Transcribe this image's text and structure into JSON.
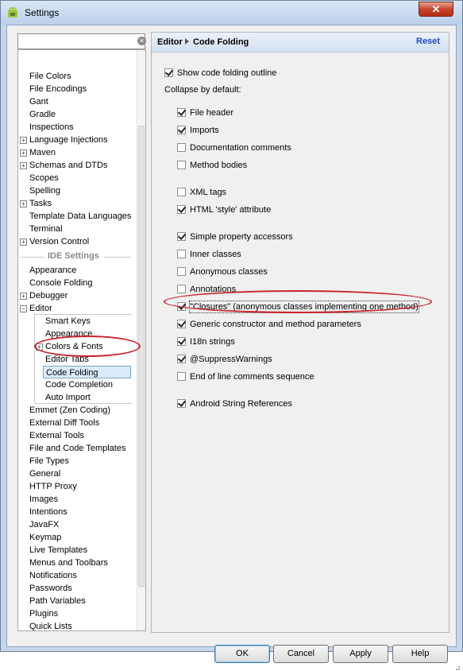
{
  "window": {
    "title": "Settings",
    "close_symbol": "✕"
  },
  "search": {
    "value": "",
    "placeholder": "",
    "clear_symbol": "✕"
  },
  "tree": {
    "top_items": [
      {
        "label": "File Colors",
        "expandable": false
      },
      {
        "label": "File Encodings",
        "expandable": false
      },
      {
        "label": "Gant",
        "expandable": false
      },
      {
        "label": "Gradle",
        "expandable": false
      },
      {
        "label": "Inspections",
        "expandable": false
      },
      {
        "label": "Language Injections",
        "expandable": true
      },
      {
        "label": "Maven",
        "expandable": true
      },
      {
        "label": "Schemas and DTDs",
        "expandable": true
      },
      {
        "label": "Scopes",
        "expandable": false
      },
      {
        "label": "Spelling",
        "expandable": false
      },
      {
        "label": "Tasks",
        "expandable": true
      },
      {
        "label": "Template Data Languages",
        "expandable": false
      },
      {
        "label": "Terminal",
        "expandable": false
      },
      {
        "label": "Version Control",
        "expandable": true
      }
    ],
    "section_label": "IDE Settings",
    "ide_items": [
      {
        "label": "Appearance",
        "expandable": false
      },
      {
        "label": "Console Folding",
        "expandable": false
      },
      {
        "label": "Debugger",
        "expandable": true
      },
      {
        "label": "Editor",
        "expandable": true,
        "expanded": true
      }
    ],
    "editor_children": [
      {
        "label": "Smart Keys",
        "expandable": false
      },
      {
        "label": "Appearance",
        "expandable": false
      },
      {
        "label": "Colors & Fonts",
        "expandable": true
      },
      {
        "label": "Editor Tabs",
        "expandable": false
      },
      {
        "label": "Code Folding",
        "expandable": false,
        "selected": true
      },
      {
        "label": "Code Completion",
        "expandable": false
      },
      {
        "label": "Auto Import",
        "expandable": false
      }
    ],
    "bottom_items": [
      {
        "label": "Emmet (Zen Coding)",
        "expandable": false
      },
      {
        "label": "External Diff Tools",
        "expandable": false
      },
      {
        "label": "External Tools",
        "expandable": false
      },
      {
        "label": "File and Code Templates",
        "expandable": false
      },
      {
        "label": "File Types",
        "expandable": false
      },
      {
        "label": "General",
        "expandable": false
      },
      {
        "label": "HTTP Proxy",
        "expandable": false
      },
      {
        "label": "Images",
        "expandable": false
      },
      {
        "label": "Intentions",
        "expandable": false
      },
      {
        "label": "JavaFX",
        "expandable": false
      },
      {
        "label": "Keymap",
        "expandable": false
      },
      {
        "label": "Live Templates",
        "expandable": false
      },
      {
        "label": "Menus and Toolbars",
        "expandable": false
      },
      {
        "label": "Notifications",
        "expandable": false
      },
      {
        "label": "Passwords",
        "expandable": false
      },
      {
        "label": "Path Variables",
        "expandable": false
      },
      {
        "label": "Plugins",
        "expandable": false
      },
      {
        "label": "Quick Lists",
        "expandable": false
      }
    ]
  },
  "panel": {
    "breadcrumb": [
      "Editor",
      "Code Folding"
    ],
    "reset_label": "Reset",
    "show_outline": {
      "label": "Show code folding outline",
      "checked": true
    },
    "collapse_label": "Collapse by default:",
    "options": [
      {
        "label": "File header",
        "checked": true
      },
      {
        "label": "Imports",
        "checked": true
      },
      {
        "label": "Documentation comments",
        "checked": false
      },
      {
        "label": "Method bodies",
        "checked": false
      },
      {
        "label": "XML tags",
        "checked": false
      },
      {
        "label": "HTML 'style' attribute",
        "checked": true
      },
      {
        "label": "Simple property accessors",
        "checked": true
      },
      {
        "label": "Inner classes",
        "checked": false
      },
      {
        "label": "Anonymous classes",
        "checked": false
      },
      {
        "label": "Annotations",
        "checked": false
      },
      {
        "label": "\"Closures\" (anonymous classes implementing one method)",
        "checked": true,
        "focused": true
      },
      {
        "label": "Generic constructor and method parameters",
        "checked": true
      },
      {
        "label": "I18n strings",
        "checked": true
      },
      {
        "label": "@SuppressWarnings",
        "checked": true
      },
      {
        "label": "End of line comments sequence",
        "checked": false
      },
      {
        "label": "Android String References",
        "checked": true
      }
    ]
  },
  "buttons": {
    "ok": "OK",
    "cancel": "Cancel",
    "apply": "Apply",
    "help": "Help"
  },
  "colors": {
    "highlight_ellipse": "#c8242c",
    "reset_link": "#1a48c8",
    "selection_bg": "#dcebfc"
  }
}
